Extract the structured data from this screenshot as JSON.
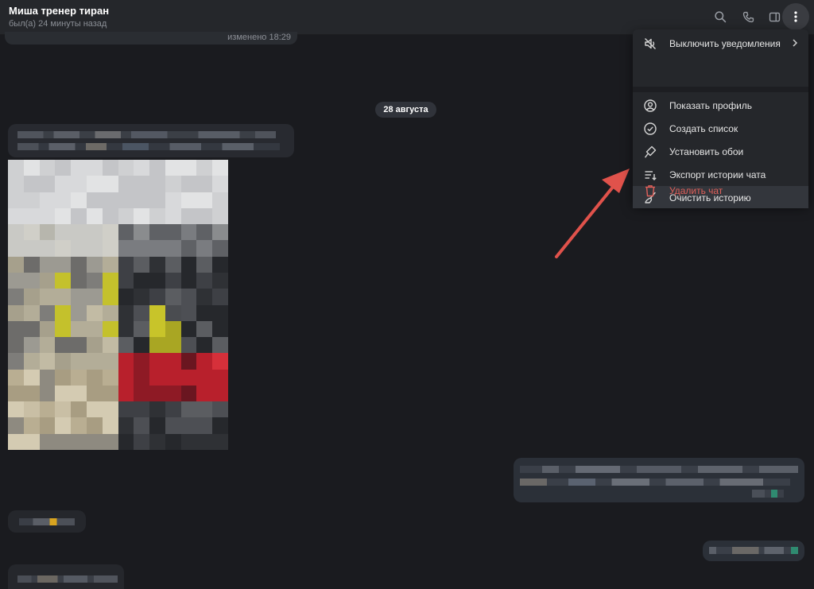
{
  "header": {
    "title": "Миша тренер тиран",
    "subtitle": "был(а) 24 минуты назад",
    "icons": [
      "search-icon",
      "phone-icon",
      "sidebar-toggle-icon",
      "more-vertical-icon"
    ]
  },
  "chat": {
    "edited_label": "изменено 18:29",
    "date_label": "28 августа"
  },
  "menu": {
    "items": [
      {
        "label": "Выключить уведомления",
        "icon": "mute-icon",
        "has_submenu": true
      },
      {
        "label": "Показать профиль",
        "icon": "profile-icon"
      },
      {
        "label": "Создать список",
        "icon": "checklist-icon"
      },
      {
        "label": "Установить обои",
        "icon": "brush-icon"
      },
      {
        "label": "Экспорт истории чата",
        "icon": "export-icon"
      },
      {
        "label": "Очистить историю",
        "icon": "broom-icon",
        "highlighted": true
      },
      {
        "label": "Удалить чат",
        "icon": "trash-icon",
        "danger": true
      }
    ]
  },
  "colors": {
    "background": "#1a1b1f",
    "header": "#25272b",
    "menu": "#25272b",
    "danger": "#e0605a",
    "annotation_arrow": "#e0524b"
  }
}
